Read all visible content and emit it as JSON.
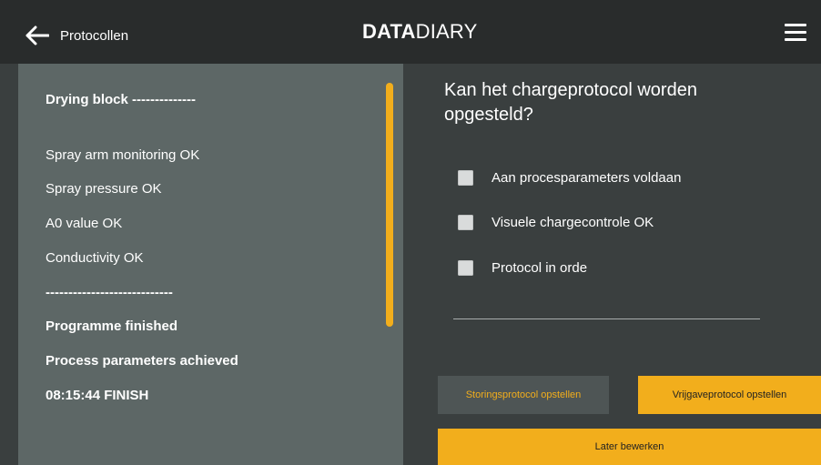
{
  "colors": {
    "accent": "#f2ae1c",
    "topbar_bg": "#292c2c",
    "page_bg": "#3a3f3f",
    "log_panel_bg": "#5d6766",
    "secondary_button_bg": "#4e5555"
  },
  "header": {
    "back_icon": "arrow-left-icon",
    "back_label": "Protocollen",
    "brand_bold": "DATA",
    "brand_light": "DIARY",
    "menu_icon": "hamburger-menu-icon"
  },
  "log": {
    "lines": [
      "Drying block --------------",
      "Spray arm monitoring OK",
      "Spray pressure OK",
      "A0 value OK",
      "Conductivity OK",
      "----------------------------",
      "Programme finished",
      "Process parameters achieved",
      "08:15:44 FINISH"
    ]
  },
  "main": {
    "question": "Kan het chargeprotocol worden opgesteld?",
    "checklist": [
      {
        "label": "Aan procesparameters voldaan",
        "checked": false
      },
      {
        "label": "Visuele chargecontrole OK",
        "checked": false
      },
      {
        "label": "Protocol in orde",
        "checked": false
      }
    ]
  },
  "actions": {
    "storing_label": "Storingsprotocol opstellen",
    "vrijgave_label": "Vrijgaveprotocol opstellen",
    "later_label": "Later bewerken"
  }
}
